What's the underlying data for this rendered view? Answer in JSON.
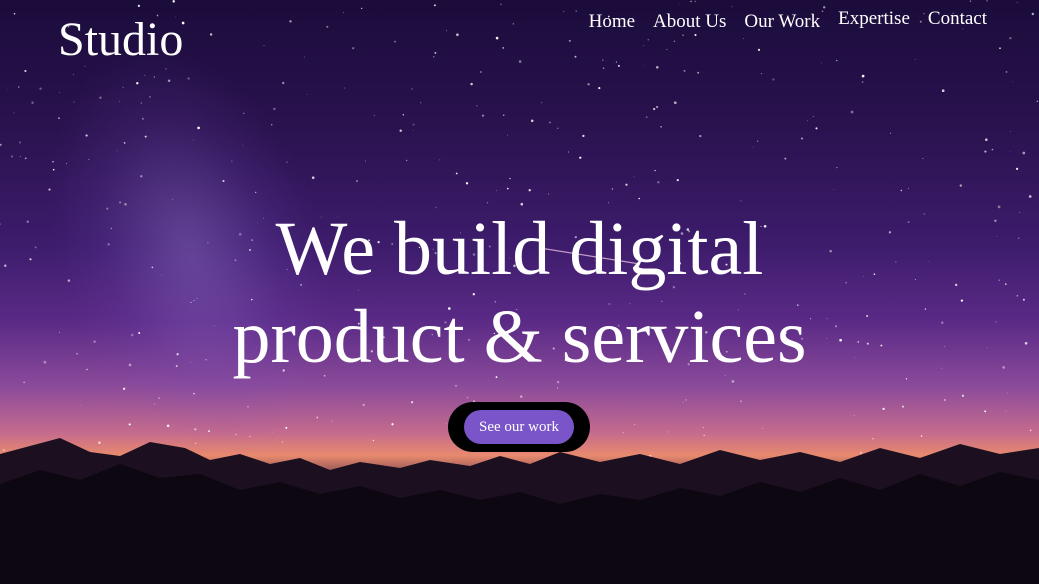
{
  "brand": {
    "name": "Studio"
  },
  "nav": {
    "items": [
      {
        "label": "Home"
      },
      {
        "label": "About Us"
      },
      {
        "label": "Our Work"
      },
      {
        "label": "Expertise"
      },
      {
        "label": "Contact"
      }
    ]
  },
  "hero": {
    "headline_line1": "We build digital",
    "headline_line2": "product & services",
    "cta_label": "See our work",
    "background": "night-sky-mountains-image"
  },
  "colors": {
    "accent": "#7a55c9",
    "cta_outline": "#000000",
    "text": "#ffffff"
  }
}
